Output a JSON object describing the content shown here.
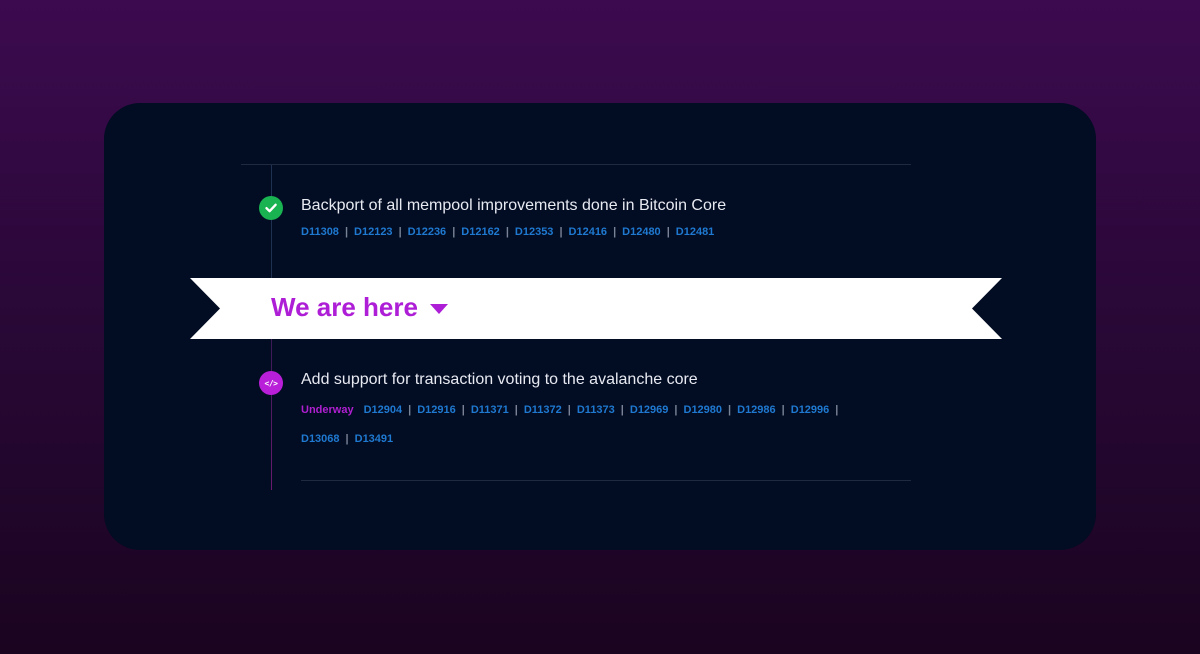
{
  "roadmap": {
    "items": [
      {
        "title": "Backport of all mempool improvements done in Bitcoin Core",
        "status": "",
        "links": [
          "D11308",
          "D12123",
          "D12236",
          "D12162",
          "D12353",
          "D12416",
          "D12480",
          "D12481"
        ]
      },
      {
        "title": "Add support for transaction voting to the avalanche core",
        "status": "Underway",
        "links_row1": [
          "D12904",
          "D12916",
          "D11371",
          "D11372",
          "D11373",
          "D12969",
          "D12980",
          "D12986",
          "D12996"
        ],
        "links_row2": [
          "D13068",
          "D13491"
        ]
      }
    ],
    "banner": {
      "label": "We are here"
    },
    "icons": {
      "done": "check-circle-icon",
      "in_progress": "code-icon",
      "code_glyph": "</>"
    },
    "colors": {
      "done": "#19b351",
      "in_progress": "#b91fd8",
      "link": "#1f79d0",
      "banner_text": "#ad1ed6"
    }
  }
}
